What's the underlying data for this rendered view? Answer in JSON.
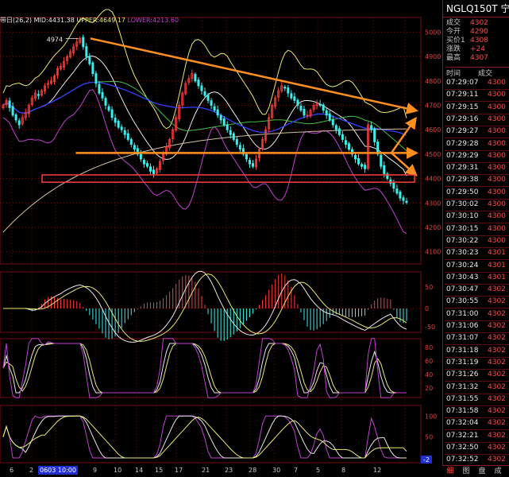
{
  "indicator_line": {
    "prefix": "带日(26,2)",
    "mid": "MID:4431.38",
    "upper": "UPPER:4649.17",
    "lower": "LOWER:4213.60"
  },
  "right_panel": {
    "title": "NGLQ150T  宁...",
    "quotes": [
      {
        "k": "成交",
        "v": "4302"
      },
      {
        "k": "今开",
        "v": "4290"
      },
      {
        "k": "买价1",
        "v": "4308"
      },
      {
        "k": "涨跌",
        "v": "+24"
      },
      {
        "k": "最高",
        "v": "4307"
      }
    ],
    "header_time": "时间",
    "header_vol": "成交",
    "trades": [
      {
        "t": "07:29:07",
        "p": "4300"
      },
      {
        "t": "07:29:11",
        "p": "4300"
      },
      {
        "t": "07:29:15",
        "p": "4300"
      },
      {
        "t": "07:29:16",
        "p": "4300"
      },
      {
        "t": "07:29:27",
        "p": "4300"
      },
      {
        "t": "07:29:28",
        "p": "4300"
      },
      {
        "t": "07:29:29",
        "p": "4300"
      },
      {
        "t": "07:29:31",
        "p": "4300"
      },
      {
        "t": "07:29:38",
        "p": "4300"
      },
      {
        "t": "07:29:50",
        "p": "4300"
      },
      {
        "t": "07:30:02",
        "p": "4300"
      },
      {
        "t": "07:30:10",
        "p": "4300"
      },
      {
        "t": "07:30:15",
        "p": "4300"
      },
      {
        "t": "07:30:22",
        "p": "4300"
      },
      {
        "t": "07:30:23",
        "p": "4301"
      },
      {
        "t": "07:30:24",
        "p": "4301"
      },
      {
        "t": "07:30:43",
        "p": "4301"
      },
      {
        "t": "07:30:47",
        "p": "4302"
      },
      {
        "t": "07:30:55",
        "p": "4302"
      },
      {
        "t": "07:31:00",
        "p": "4302"
      },
      {
        "t": "07:31:06",
        "p": "4302"
      },
      {
        "t": "07:31:07",
        "p": "4302"
      },
      {
        "t": "07:31:18",
        "p": "4302"
      },
      {
        "t": "07:31:19",
        "p": "4302"
      },
      {
        "t": "07:31:26",
        "p": "4302"
      },
      {
        "t": "07:31:32",
        "p": "4302"
      },
      {
        "t": "07:31:55",
        "p": "4302"
      },
      {
        "t": "07:31:58",
        "p": "4302"
      },
      {
        "t": "07:32:04",
        "p": "4302"
      },
      {
        "t": "07:32:21",
        "p": "4302"
      },
      {
        "t": "07:32:50",
        "p": "4302"
      },
      {
        "t": "07:32:52",
        "p": "4302"
      }
    ],
    "bottom_tabs": [
      "细",
      "图",
      "盘",
      "成"
    ]
  },
  "colors": {
    "up": "#ff3c3c",
    "down": "#3cf0f0",
    "mid": "#e8e8e8",
    "upper": "#e8e870",
    "lower": "#c040d0",
    "ma_green": "#40c040",
    "ma_blue": "#3040ff",
    "ma_tan": "#d0c0a0",
    "arrow": "#ff9020",
    "grid": "#6a0a0a"
  },
  "chart_data": {
    "type": "candlestick",
    "price_axis_ticks": [
      5000,
      4900,
      4800,
      4700,
      4600,
      4500,
      4400,
      4300,
      4200,
      4100
    ],
    "price_axis_labels": [
      "5000",
      "4900",
      "4800",
      "4700",
      "4600",
      "4500",
      "4400",
      "4300",
      "4200",
      "4100"
    ],
    "price_range": [
      4050,
      5060
    ],
    "peak_annotation": "4974",
    "peak_value": 4974,
    "x_tick_labels": [
      "6",
      "2",
      "0603 10:00",
      "9",
      "10",
      "14",
      "15",
      "17",
      "21",
      "23",
      "28",
      "30",
      "7",
      "5",
      "8",
      "12"
    ],
    "highlighted_x_label": "0603 10:00",
    "close": [
      4700,
      4720,
      4690,
      4660,
      4640,
      4620,
      4650,
      4670,
      4700,
      4730,
      4750,
      4740,
      4760,
      4780,
      4790,
      4800,
      4820,
      4850,
      4860,
      4880,
      4900,
      4920,
      4940,
      4960,
      4974,
      4940,
      4900,
      4870,
      4830,
      4790,
      4750,
      4730,
      4700,
      4680,
      4650,
      4630,
      4610,
      4600,
      4580,
      4560,
      4540,
      4520,
      4500,
      4480,
      4460,
      4450,
      4430,
      4420,
      4440,
      4470,
      4500,
      4530,
      4560,
      4600,
      4650,
      4700,
      4750,
      4790,
      4810,
      4830,
      4800,
      4780,
      4760,
      4740,
      4720,
      4700,
      4680,
      4660,
      4640,
      4620,
      4600,
      4580,
      4560,
      4540,
      4520,
      4500,
      4480,
      4460,
      4450,
      4480,
      4520,
      4560,
      4600,
      4650,
      4700,
      4730,
      4760,
      4780,
      4770,
      4750,
      4730,
      4720,
      4700,
      4680,
      4660,
      4660,
      4680,
      4700,
      4710,
      4700,
      4680,
      4660,
      4640,
      4620,
      4600,
      4580,
      4560,
      4540,
      4520,
      4500,
      4480,
      4460,
      4450,
      4440,
      4620,
      4600,
      4550,
      4500,
      4450,
      4420,
      4400,
      4380,
      4360,
      4340,
      4320,
      4310,
      4302
    ],
    "trendlines": [
      {
        "name": "upper-resistance",
        "from": [
          0.215,
          4974
        ],
        "to": [
          0.985,
          4680
        ]
      },
      {
        "name": "horizontal-support",
        "from": [
          0.18,
          4505
        ],
        "to": [
          0.985,
          4505
        ]
      }
    ],
    "support_box": {
      "low": 4385,
      "high": 4415,
      "x_from": 0.1,
      "x_to": 0.985
    },
    "macd_ticks": [
      "50",
      "0",
      "-50"
    ],
    "kdj_ticks": [
      "80",
      "60",
      "40",
      "20"
    ],
    "rsi_ticks": [
      "100",
      "50"
    ],
    "bottom_right_value": "-2"
  }
}
